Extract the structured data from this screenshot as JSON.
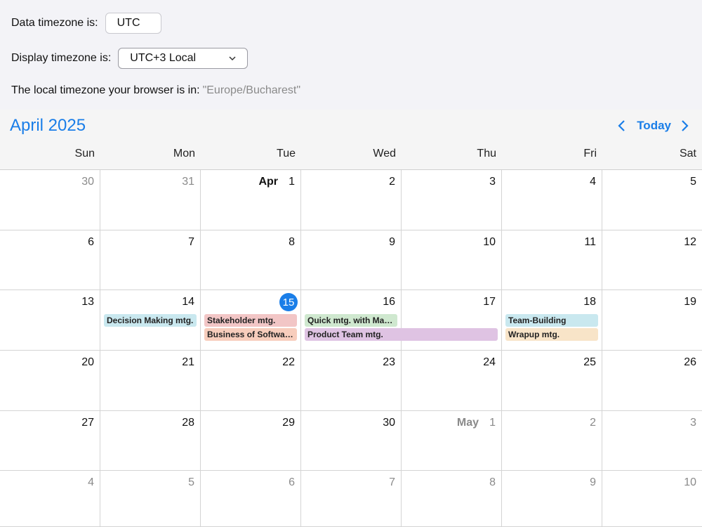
{
  "controls": {
    "data_tz_label": "Data timezone is:",
    "data_tz_value": "UTC",
    "display_tz_label": "Display timezone is:",
    "display_tz_value": "UTC+3 Local",
    "local_tz_label": "The local timezone your browser is in:",
    "local_tz_value": "\"Europe/Bucharest\""
  },
  "calendar": {
    "title": "April 2025",
    "today_label": "Today",
    "weekdays": [
      "Sun",
      "Mon",
      "Tue",
      "Wed",
      "Thu",
      "Fri",
      "Sat"
    ],
    "weeks": [
      [
        {
          "n": "30",
          "other": true
        },
        {
          "n": "31",
          "other": true
        },
        {
          "n": "1",
          "month": "Apr"
        },
        {
          "n": "2"
        },
        {
          "n": "3"
        },
        {
          "n": "4"
        },
        {
          "n": "5"
        }
      ],
      [
        {
          "n": "6"
        },
        {
          "n": "7"
        },
        {
          "n": "8"
        },
        {
          "n": "9"
        },
        {
          "n": "10"
        },
        {
          "n": "11"
        },
        {
          "n": "12"
        }
      ],
      [
        {
          "n": "13"
        },
        {
          "n": "14"
        },
        {
          "n": "15",
          "today": true
        },
        {
          "n": "16"
        },
        {
          "n": "17"
        },
        {
          "n": "18"
        },
        {
          "n": "19"
        }
      ],
      [
        {
          "n": "20"
        },
        {
          "n": "21"
        },
        {
          "n": "22"
        },
        {
          "n": "23"
        },
        {
          "n": "24"
        },
        {
          "n": "25"
        },
        {
          "n": "26"
        }
      ],
      [
        {
          "n": "27"
        },
        {
          "n": "28"
        },
        {
          "n": "29"
        },
        {
          "n": "30"
        },
        {
          "n": "1",
          "month": "May",
          "other": true
        },
        {
          "n": "2",
          "other": true
        },
        {
          "n": "3",
          "other": true
        }
      ],
      [
        {
          "n": "4",
          "other": true
        },
        {
          "n": "5",
          "other": true
        },
        {
          "n": "6",
          "other": true
        },
        {
          "n": "7",
          "other": true
        },
        {
          "n": "8",
          "other": true
        },
        {
          "n": "9",
          "other": true
        },
        {
          "n": "10",
          "other": true
        }
      ]
    ],
    "events": [
      {
        "title": "Decision Making mtg.",
        "week": 2,
        "col": 1,
        "span": 1,
        "slot": 0,
        "color": "#c9e8ef"
      },
      {
        "title": "Stakeholder mtg.",
        "week": 2,
        "col": 2,
        "span": 1,
        "slot": 0,
        "color": "#f2c6c6"
      },
      {
        "title": "Business of Software Conference",
        "week": 2,
        "col": 2,
        "span": 1,
        "slot": 1,
        "color": "#f7cdbc"
      },
      {
        "title": "Quick mtg. with Martin",
        "week": 2,
        "col": 3,
        "span": 1,
        "slot": 0,
        "color": "#cfe8cf"
      },
      {
        "title": "Product Team mtg.",
        "week": 2,
        "col": 3,
        "span": 2,
        "slot": 1,
        "color": "#dfc3e3"
      },
      {
        "title": "Team-Building",
        "week": 2,
        "col": 5,
        "span": 1,
        "slot": 0,
        "color": "#c9e8ef"
      },
      {
        "title": "Wrapup mtg.",
        "week": 2,
        "col": 5,
        "span": 1,
        "slot": 1,
        "color": "#f8e4c8"
      }
    ]
  }
}
